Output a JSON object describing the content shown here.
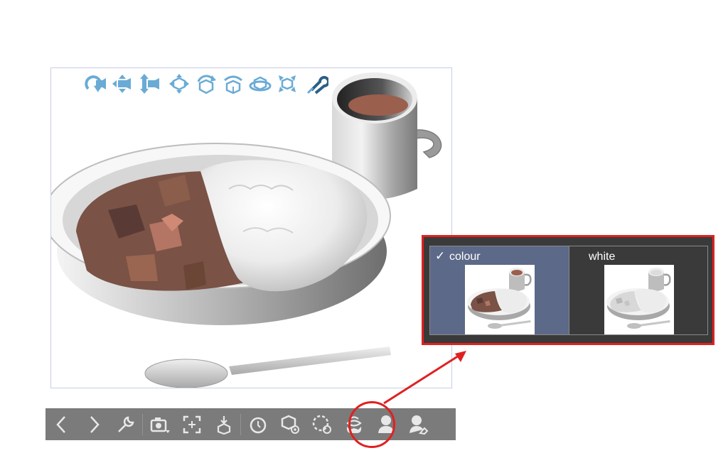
{
  "viewport": {
    "camera_tools": [
      {
        "name": "rotate-camera-icon"
      },
      {
        "name": "pan-camera-icon"
      },
      {
        "name": "dolly-camera-icon"
      },
      {
        "name": "move-object-icon"
      },
      {
        "name": "rotate-object-icon"
      },
      {
        "name": "rotate-object-axis-icon"
      },
      {
        "name": "rotate-object-plane-icon"
      },
      {
        "name": "scale-object-icon"
      },
      {
        "name": "snap-icon"
      }
    ]
  },
  "bottom_toolbar": {
    "buttons": [
      {
        "name": "previous-icon"
      },
      {
        "name": "next-icon"
      },
      {
        "name": "wrench-icon"
      },
      {
        "name": "camera-angle-icon"
      },
      {
        "name": "fit-to-view-icon"
      },
      {
        "name": "place-on-ground-icon"
      },
      {
        "name": "timer-icon"
      },
      {
        "name": "object-settings-icon"
      },
      {
        "name": "reset-rotation-icon"
      },
      {
        "name": "texture-mode-icon"
      },
      {
        "name": "pose-icon"
      },
      {
        "name": "hand-pose-icon"
      }
    ],
    "highlighted": "texture-mode-icon"
  },
  "texture_popup": {
    "options": [
      {
        "label": "colour",
        "selected": true
      },
      {
        "label": "white",
        "selected": false
      }
    ],
    "selected_bg": "#5c6988",
    "panel_bg": "#3a3a3a"
  },
  "accent_color": "#e02020",
  "tool_color": "#6aabd6"
}
